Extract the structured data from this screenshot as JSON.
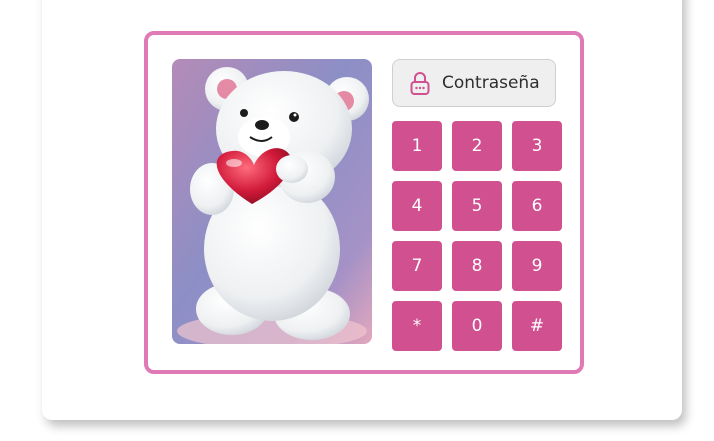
{
  "password": {
    "label": "Contraseña",
    "icon": "lock-icon"
  },
  "keypad": {
    "keys": [
      "1",
      "2",
      "3",
      "4",
      "5",
      "6",
      "7",
      "8",
      "9",
      "*",
      "0",
      "#"
    ]
  },
  "photo": {
    "subject": "teddy-bear-with-heart-image"
  },
  "colors": {
    "accent": "#d1508f",
    "border": "#e07ab7",
    "field_bg": "#efefef"
  }
}
